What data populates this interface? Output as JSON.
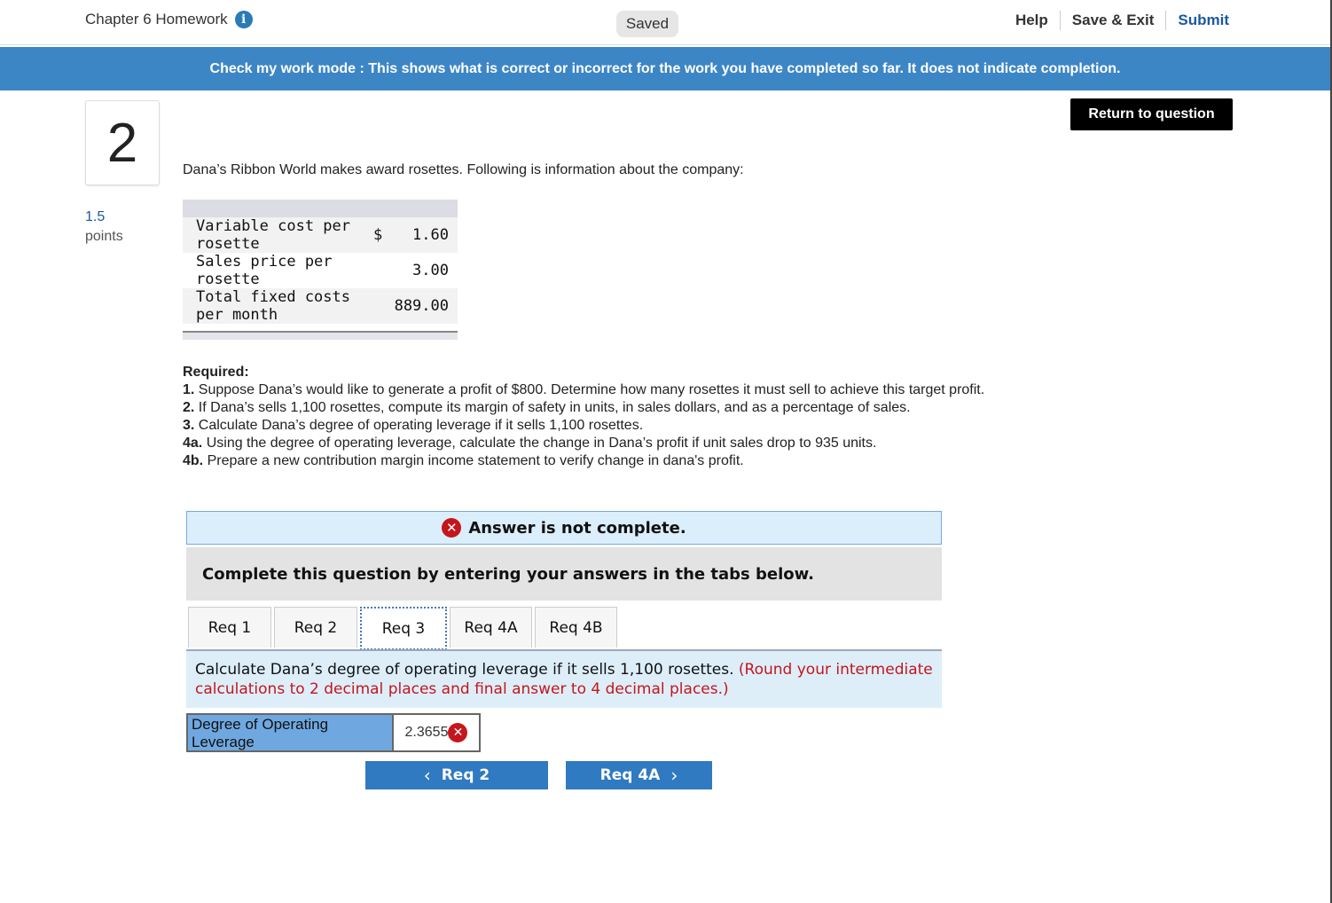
{
  "header": {
    "chapter_title": "Chapter 6 Homework",
    "saved_label": "Saved",
    "help_label": "Help",
    "save_exit_label": "Save & Exit",
    "submit_label": "Submit"
  },
  "banner": {
    "text": "Check my work mode : This shows what is correct or incorrect for the work you have completed so far. It does not indicate completion."
  },
  "question": {
    "number": "2",
    "points_value": "1.5",
    "points_label": "points",
    "return_label": "Return to question",
    "intro": "Dana’s Ribbon World makes award rosettes. Following is information about the company:"
  },
  "data_table": {
    "rows": [
      {
        "label": "Variable cost per rosette",
        "dollar": "$",
        "value": "1.60"
      },
      {
        "label": "Sales price per rosette",
        "dollar": "",
        "value": "3.00"
      },
      {
        "label": "Total fixed costs per month",
        "dollar": "",
        "value": "889.00"
      }
    ]
  },
  "required": {
    "heading": "Required:",
    "items": [
      {
        "key": "1.",
        "text": "Suppose Dana’s would like to generate a profit of $800. Determine how many rosettes it must sell to achieve this target profit."
      },
      {
        "key": "2.",
        "text": "If Dana’s sells 1,100 rosettes, compute its margin of safety in units, in sales dollars, and as a percentage of sales."
      },
      {
        "key": "3.",
        "text": "Calculate Dana’s degree of operating leverage if it sells 1,100 rosettes."
      },
      {
        "key": "4a.",
        "text": "Using the degree of operating leverage, calculate the change in Dana’s profit if unit sales drop to 935 units."
      },
      {
        "key": "4b.",
        "text": "Prepare a new contribution margin income statement to verify change in dana's profit."
      }
    ]
  },
  "answer_notice": {
    "icon": "x-circle-icon",
    "text": "Answer is not complete."
  },
  "instructions": "Complete this question by entering your answers in the tabs below.",
  "tabs": [
    {
      "label": "Req 1"
    },
    {
      "label": "Req 2"
    },
    {
      "label": "Req 3"
    },
    {
      "label": "Req 4A"
    },
    {
      "label": "Req 4B"
    }
  ],
  "active_tab": "Req 3",
  "tab_question": {
    "text": "Calculate Dana’s degree of operating leverage if it sells 1,100 rosettes.",
    "hint": "(Round your intermediate calculations to 2 decimal places and final answer to 4 decimal places.)"
  },
  "answer": {
    "label": "Degree of Operating Leverage",
    "value": "2.3655",
    "status_icon": "x-circle-icon"
  },
  "nav": {
    "prev_label": "Req 2",
    "next_label": "Req 4A"
  },
  "colors": {
    "banner": "#3d86c6",
    "link_blue": "#1b5aa0",
    "error_red": "#c4161c",
    "nav_button": "#2f7ac0",
    "answer_label_bg": "#6fa8e0"
  }
}
